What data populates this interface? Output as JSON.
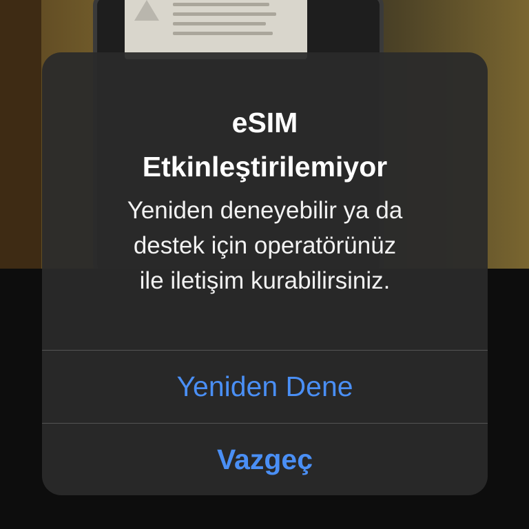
{
  "alert": {
    "title_line1": "eSIM",
    "title_line2": "Etkinleştirilemiyor",
    "message_line1": "Yeniden deneyebilir ya da",
    "message_line2": "destek için operatörünüz",
    "message_line3": "ile iletişim kurabilirsiniz.",
    "retry_label": "Yeniden Dene",
    "cancel_label": "Vazgeç"
  },
  "colors": {
    "accent": "#4a8ff5",
    "alert_background": "#2a2a2a",
    "title_text": "#ffffff"
  },
  "icons": {
    "background_warning": "warning-triangle-icon"
  }
}
